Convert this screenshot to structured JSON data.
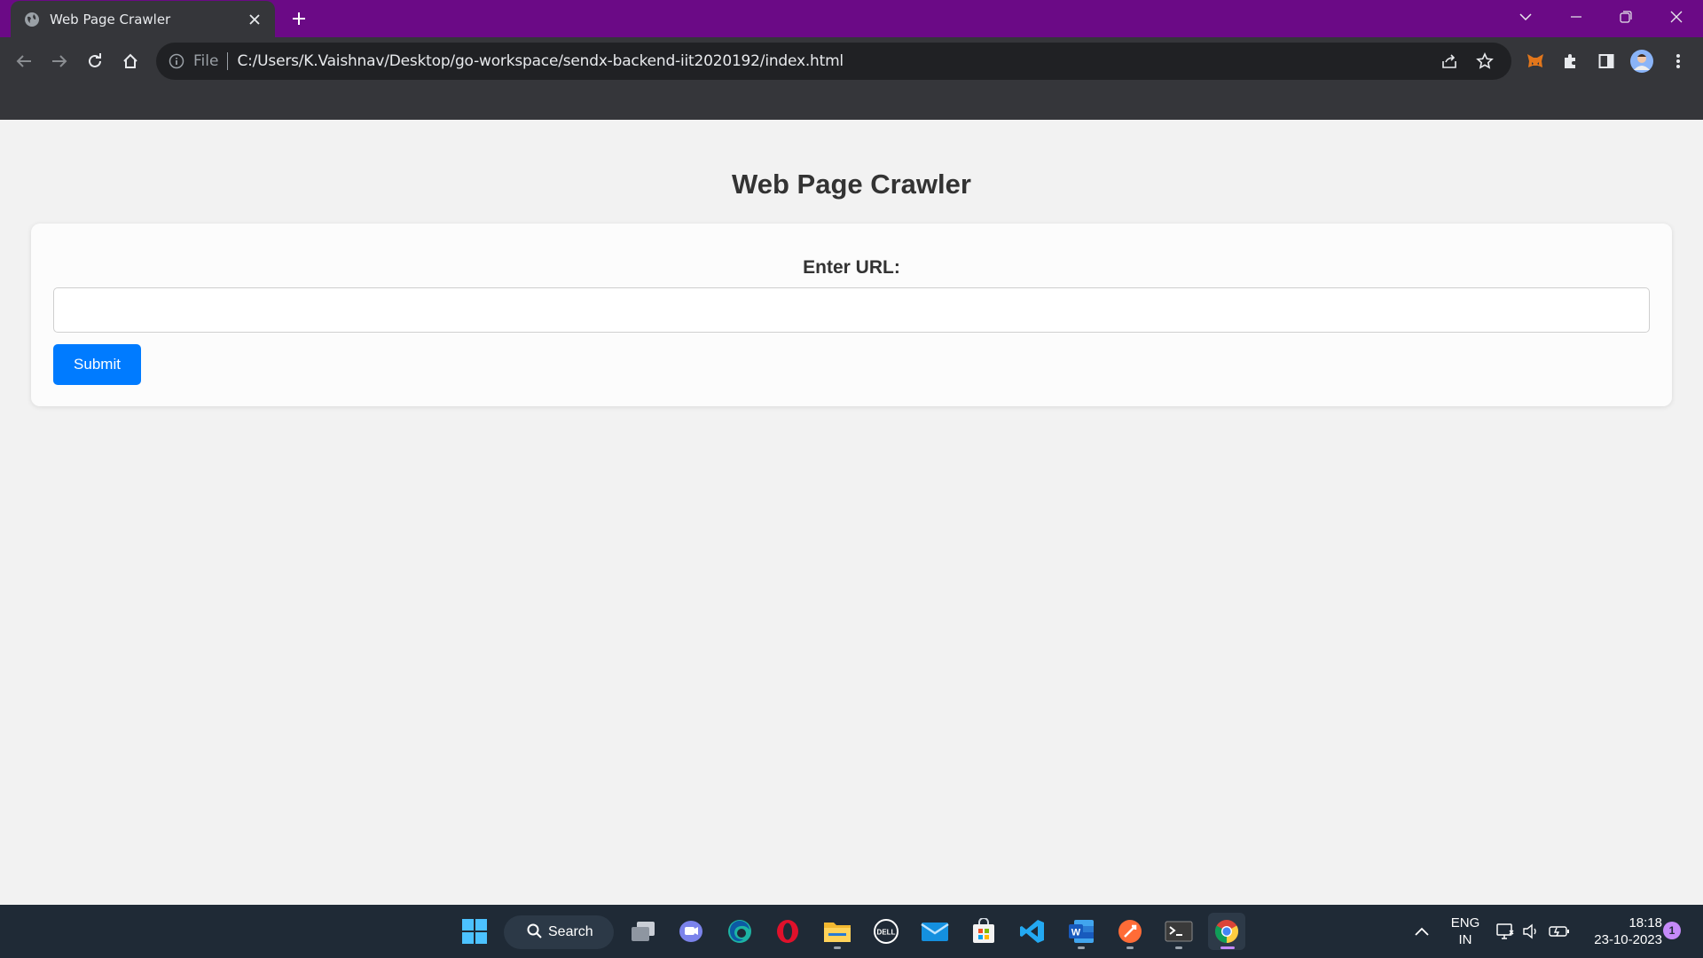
{
  "browser": {
    "tab": {
      "title": "Web Page Crawler",
      "favicon": "globe-icon"
    },
    "address": {
      "scheme_label": "File",
      "url": "C:/Users/K.Vaishnav/Desktop/go-workspace/sendx-backend-iit2020192/index.html"
    },
    "colors": {
      "tab_strip": "#6b0a86",
      "toolbar": "#35363a",
      "omnibox": "#202124"
    }
  },
  "page": {
    "heading": "Web Page Crawler",
    "form": {
      "label": "Enter URL:",
      "input_value": "",
      "submit_label": "Submit"
    },
    "colors": {
      "background": "#f2f2f2",
      "card": "#fcfcfc",
      "button": "#007bff"
    }
  },
  "taskbar": {
    "search_label": "Search",
    "apps": [
      "windows-start-icon",
      "task-view-icon",
      "teams-chat-icon",
      "edge-icon",
      "opera-icon",
      "file-explorer-icon",
      "dell-icon",
      "mail-icon",
      "microsoft-store-icon",
      "vscode-icon",
      "word-icon",
      "postman-icon",
      "terminal-icon",
      "chrome-icon"
    ],
    "language": {
      "line1": "ENG",
      "line2": "IN"
    },
    "clock": {
      "time": "18:18",
      "date": "23-10-2023"
    },
    "notification_count": "1",
    "colors": {
      "background": "#1f2a36",
      "accent": "#c58af9"
    }
  }
}
